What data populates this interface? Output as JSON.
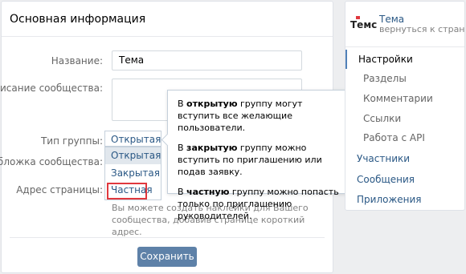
{
  "main": {
    "title": "Основная информация",
    "fields": {
      "name_label": "Название:",
      "name_value": "Тема",
      "description_label": "Описание сообщества:",
      "group_type_label": "Тип группы:",
      "cover_label": "Обложка сообщества:",
      "address_label": "Адрес страницы:"
    },
    "group_type": {
      "current": "Открытая",
      "options": [
        "Открытая",
        "Закрытая",
        "Частная"
      ]
    },
    "hint": "Вы можете создать наклейки для Вашего сообщества, добавив странице короткий адрес.",
    "save_label": "Сохранить"
  },
  "tooltip": {
    "p1_pre": "В ",
    "p1_bold": "открытую",
    "p1_post": " группу могут вступить все желающие пользователи.",
    "p2_pre": "В ",
    "p2_bold": "закрытую",
    "p2_post": " группу можно вступить по приглашению или подав заявку.",
    "p3_pre": "В ",
    "p3_bold": "частную",
    "p3_post": " группу можно попасть только по приглашению руководителей."
  },
  "sidebar": {
    "logo_text": "Темс",
    "group_name": "Тема",
    "back_link": "вернуться к странице",
    "items": [
      {
        "label": "Настройки",
        "kind": "active"
      },
      {
        "label": "Разделы",
        "kind": "sub"
      },
      {
        "label": "Комментарии",
        "kind": "sub"
      },
      {
        "label": "Ссылки",
        "kind": "sub"
      },
      {
        "label": "Работа с API",
        "kind": "sub"
      },
      {
        "label": "Участники",
        "kind": "link"
      },
      {
        "label": "Сообщения",
        "kind": "link"
      },
      {
        "label": "Приложения",
        "kind": "link"
      }
    ]
  },
  "colors": {
    "accent": "#5181b8",
    "button": "#5e81a8",
    "link": "#2a5885",
    "highlight_border": "#e0383e"
  }
}
